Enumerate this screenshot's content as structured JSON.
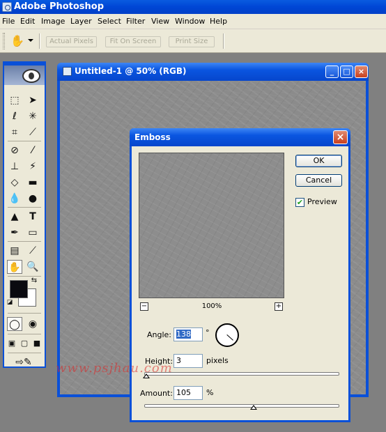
{
  "app": {
    "title": "Adobe Photoshop"
  },
  "menu": [
    "File",
    "Edit",
    "Image",
    "Layer",
    "Select",
    "Filter",
    "View",
    "Window",
    "Help"
  ],
  "options_bar": {
    "tool_icon": "hand-icon",
    "buttons": [
      "Actual Pixels",
      "Fit On Screen",
      "Print Size"
    ]
  },
  "document": {
    "title": "Untitled-1 @ 50% (RGB)"
  },
  "dialog": {
    "title": "Emboss",
    "ok_label": "OK",
    "cancel_label": "Cancel",
    "preview_label": "Preview",
    "preview_checked": true,
    "zoom_label": "100%",
    "zoom_out": "−",
    "zoom_in": "+",
    "angle": {
      "label": "Angle:",
      "value": "138",
      "unit": "°"
    },
    "height": {
      "label": "Height:",
      "value": "3",
      "unit": "pixels",
      "slider_fraction": 0.01
    },
    "amount": {
      "label": "Amount:",
      "value": "105",
      "unit": "%",
      "slider_fraction": 0.56
    }
  },
  "watermark": "www.psjhau.com",
  "colors": {
    "title_blue": "#0a50d8",
    "panel": "#ece9d8",
    "canvas_gray": "#8b8b8b",
    "foreground": "#0a0a10",
    "background": "#ffffff"
  }
}
